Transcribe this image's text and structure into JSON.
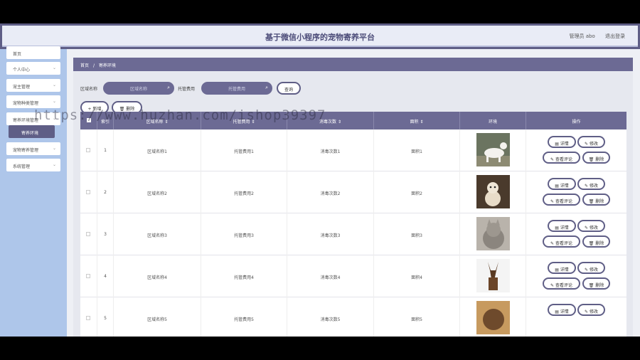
{
  "header": {
    "title": "基于微信小程序的宠物寄养平台",
    "user_label": "管理员 abo",
    "logout_label": "退出登录"
  },
  "sidebar": {
    "items": [
      {
        "label": "首页",
        "chevron": ""
      },
      {
        "label": "个人中心",
        "chevron": "⌄"
      },
      {
        "label": "宠主管理",
        "chevron": "⌄"
      },
      {
        "label": "宠物种类管理",
        "chevron": "⌄"
      },
      {
        "label": "寄养环境管理",
        "chevron": "⌄"
      },
      {
        "label": "寄养环境",
        "chevron": ""
      },
      {
        "label": "宠物寄养管理",
        "chevron": "⌄"
      },
      {
        "label": "系统管理",
        "chevron": "⌄"
      }
    ]
  },
  "breadcrumb": {
    "home": "首页",
    "sep": "/",
    "current": "寄养环境"
  },
  "search": {
    "area_label": "区域名称",
    "area_placeholder": "区域名称",
    "fee_label": "托管费用",
    "fee_placeholder": "托管费用",
    "query_button": "查询"
  },
  "actions": {
    "add": "+ 新增",
    "delete": "删除"
  },
  "table": {
    "headers": [
      "",
      "索引",
      "区域名称 ⇕",
      "托管费用 ⇕",
      "消毒次数 ⇕",
      "面积 ⇕",
      "环境",
      "操作"
    ],
    "rows": [
      {
        "index": "1",
        "area": "区域名称1",
        "fee": "托管费用1",
        "disinfect": "消毒次数1",
        "size": "面积1",
        "image": "white-dog"
      },
      {
        "index": "2",
        "area": "区域名称2",
        "fee": "托管费用2",
        "disinfect": "消毒次数2",
        "size": "面积2",
        "image": "small-dog-sitting"
      },
      {
        "index": "3",
        "area": "区域名称3",
        "fee": "托管费用3",
        "disinfect": "消毒次数3",
        "size": "面积3",
        "image": "grey-cat"
      },
      {
        "index": "4",
        "area": "区域名称4",
        "fee": "托管费用4",
        "disinfect": "消毒次数4",
        "size": "面积4",
        "image": "brown-dog"
      },
      {
        "index": "5",
        "area": "区域名称5",
        "fee": "托管费用5",
        "disinfect": "消毒次数5",
        "size": "面积5",
        "image": "brown-cat"
      }
    ],
    "row_actions": {
      "detail": "详情",
      "edit": "修改",
      "review": "查看评论",
      "delete": "删除"
    }
  },
  "watermark": "https://www.huzhan.com/ishop39397",
  "colors": {
    "primary": "#6c6a94",
    "sidebar": "#aec6ea",
    "background": "#e6e8ef"
  }
}
